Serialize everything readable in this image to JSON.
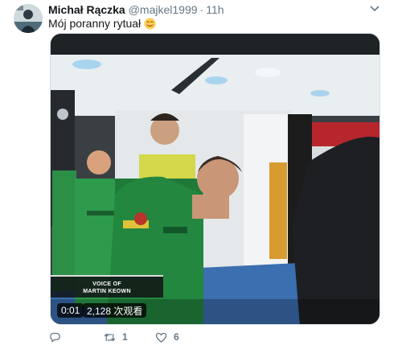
{
  "tweet": {
    "display_name": "Michał Rączka",
    "handle": "@majkel1999",
    "separator": "·",
    "time": "11h",
    "text": "Mój poranny rytuał",
    "emoji": "smiling-face-icon"
  },
  "media": {
    "caption_line1": "VOICE OF",
    "caption_line2": "MARTIN KEOWN",
    "duration": "0:01",
    "views": "2,128 次观看"
  },
  "actions": {
    "reply_count": "",
    "retweet_count": "1",
    "like_count": "6"
  },
  "colors": {
    "text_primary": "#14171a",
    "text_secondary": "#657786",
    "kit_green": "#1f7a3a",
    "background": "#ffffff"
  }
}
